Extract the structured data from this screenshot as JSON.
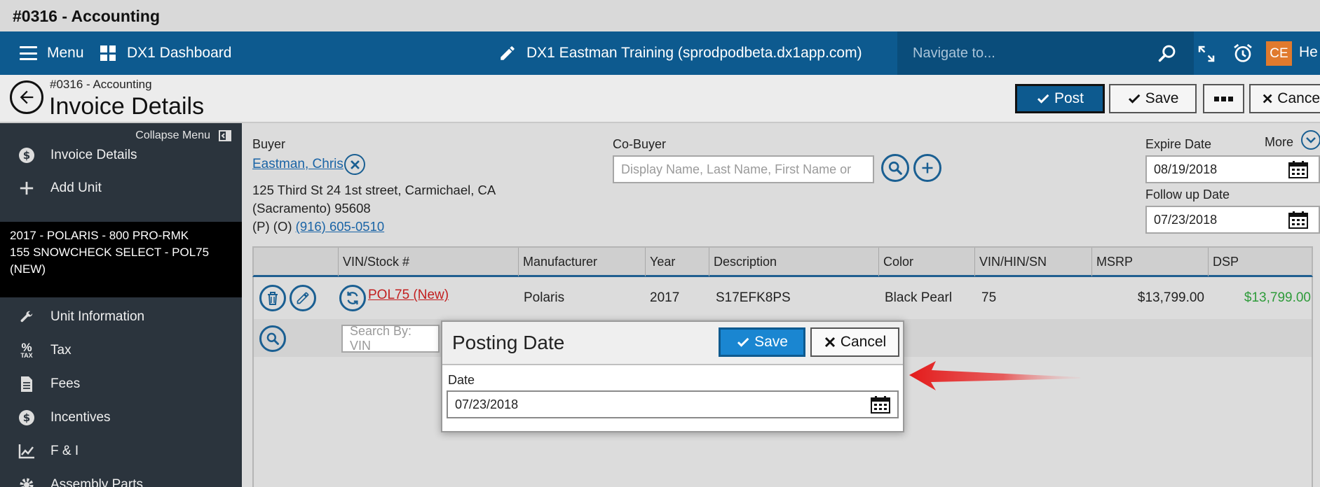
{
  "window": {
    "title": "#0316 - Accounting"
  },
  "topbar": {
    "menu_label": "Menu",
    "dashboard_label": "DX1 Dashboard",
    "site_label": "DX1 Eastman Training (sprodpodbeta.dx1app.com)",
    "search_placeholder": "Navigate to...",
    "avatar_initials": "CE",
    "help_label": "He"
  },
  "header": {
    "breadcrumb": "#0316 - Accounting",
    "title": "Invoice Details",
    "post_label": "Post",
    "save_label": "Save",
    "more_label": "▪▪▪",
    "cancel_label": "Cance"
  },
  "sidebar": {
    "collapse_label": "Collapse Menu",
    "items_top": [
      {
        "label": "Invoice Details",
        "icon": "dollar-circle-icon"
      },
      {
        "label": "Add Unit",
        "icon": "plus-icon"
      }
    ],
    "unit_lines": [
      "2017 - POLARIS - 800 PRO-RMK",
      "155 SNOWCHECK SELECT - POL75",
      "(NEW)"
    ],
    "items_bottom": [
      {
        "label": "Unit Information",
        "icon": "wrench-icon"
      },
      {
        "label": "Tax",
        "icon": "percent-tax-icon"
      },
      {
        "label": "Fees",
        "icon": "document-icon"
      },
      {
        "label": "Incentives",
        "icon": "dollar-circle-icon"
      },
      {
        "label": "F & I",
        "icon": "chart-line-icon"
      },
      {
        "label": "Assembly Parts",
        "icon": "gear-icon"
      }
    ]
  },
  "buyer": {
    "label": "Buyer",
    "name": "Eastman, Chris",
    "address1": "125 Third St 24 1st street, Carmichael, CA",
    "address2": "(Sacramento) 95608",
    "phone_prefix": "(P) (O) ",
    "phone": "(916) 605-0510"
  },
  "cobuyer": {
    "label": "Co-Buyer",
    "placeholder": "Display Name, Last Name, First Name or"
  },
  "dates": {
    "expire_label": "Expire Date",
    "expire_value": "08/19/2018",
    "followup_label": "Follow up Date",
    "followup_value": "07/23/2018",
    "more_label": "More"
  },
  "table": {
    "columns": [
      "VIN/Stock #",
      "Manufacturer",
      "Year",
      "Description",
      "Color",
      "VIN/HIN/SN",
      "MSRP",
      "DSP"
    ],
    "row": {
      "stock": "POL75 (New)",
      "manufacturer": "Polaris",
      "year": "2017",
      "description": "S17EFK8PS",
      "color": "Black Pearl",
      "vin": "75",
      "msrp": "$13,799.00",
      "dsp": "$13,799.00"
    },
    "search_placeholder": "Search By: VIN"
  },
  "modal": {
    "title": "Posting Date",
    "save_label": "Save",
    "cancel_label": "Cancel",
    "date_label": "Date",
    "date_value": "07/23/2018"
  },
  "colors": {
    "nav": "#0d5a8f",
    "sidebar": "#2b343d",
    "accent_orange": "#e07a2e",
    "dsp_green": "#2e9b3a",
    "link_red": "#c21e1e",
    "arrow_red": "#e31b1b"
  }
}
